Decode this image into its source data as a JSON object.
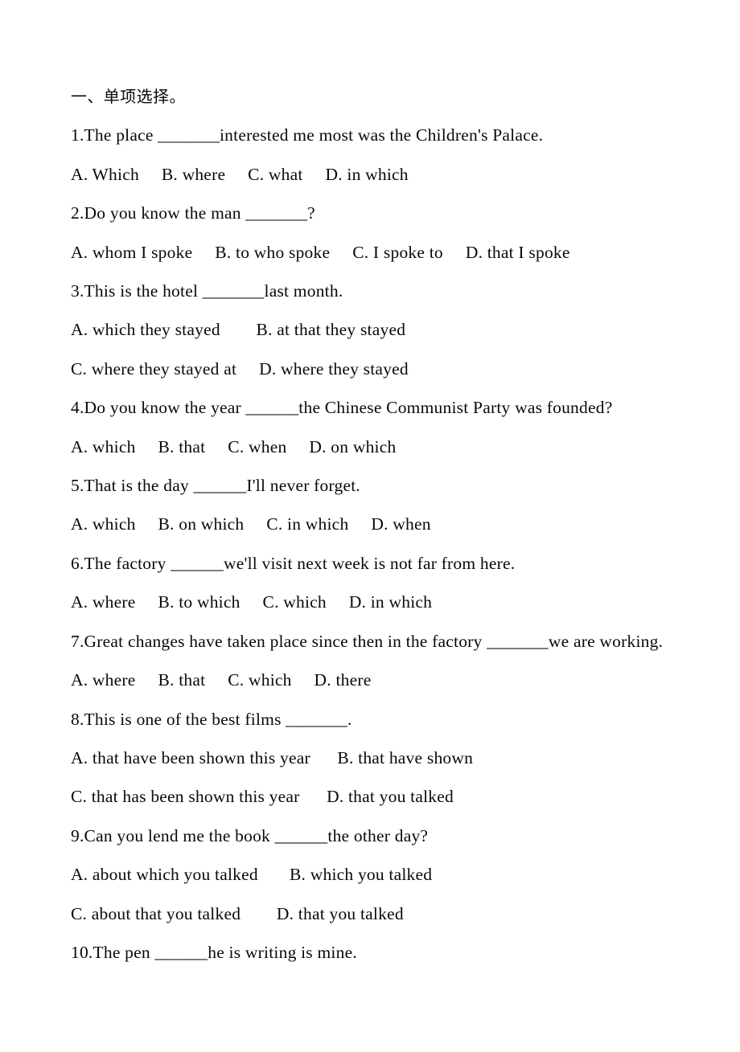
{
  "document": {
    "title": "一、单项选择。",
    "background_color": "#ffffff",
    "text_color": "#000000",
    "heading": "一、单项选择。",
    "lines": [
      {
        "id": "heading",
        "kind": "heading",
        "text": "一、单项选择。"
      },
      {
        "id": "q1",
        "kind": "question",
        "text": "1.The place _______interested me most was the Children's Palace."
      },
      {
        "id": "q1-opts",
        "kind": "options",
        "text": "A. Which     B. where     C. what     D. in which"
      },
      {
        "id": "q2",
        "kind": "question",
        "text": "2.Do you know the man _______?"
      },
      {
        "id": "q2-opts",
        "kind": "options",
        "text": "A. whom I spoke     B. to who spoke     C. I spoke to     D. that I spoke"
      },
      {
        "id": "q3",
        "kind": "question",
        "text": "3.This is the hotel _______last month."
      },
      {
        "id": "q3-optsAB",
        "kind": "options",
        "text": "A. which they stayed        B. at that they stayed"
      },
      {
        "id": "q3-optsCD",
        "kind": "options",
        "text": "C. where they stayed at     D. where they stayed"
      },
      {
        "id": "q4",
        "kind": "question",
        "text": "4.Do you know the year ______the Chinese Communist Party was founded?"
      },
      {
        "id": "q4-opts",
        "kind": "options",
        "text": "A. which     B. that     C. when     D. on which"
      },
      {
        "id": "q5",
        "kind": "question",
        "text": "5.That is the day ______I'll never forget."
      },
      {
        "id": "q5-opts",
        "kind": "options",
        "text": "A. which     B. on which     C. in which     D. when"
      },
      {
        "id": "q6",
        "kind": "question",
        "text": "6.The factory ______we'll visit next week is not far from here."
      },
      {
        "id": "q6-opts",
        "kind": "options",
        "text": "A. where     B. to which     C. which     D. in which"
      },
      {
        "id": "q7",
        "kind": "question",
        "text": "7.Great changes have taken place since then in the factory _______we are working."
      },
      {
        "id": "q7-opts",
        "kind": "options",
        "text": "A. where     B. that     C. which     D. there"
      },
      {
        "id": "q8",
        "kind": "question",
        "text": "8.This is one of the best films _______."
      },
      {
        "id": "q8-optsAB",
        "kind": "options",
        "text": "A. that have been shown this year      B. that have shown"
      },
      {
        "id": "q8-optsCD",
        "kind": "options",
        "text": "C. that has been shown this year      D. that you talked"
      },
      {
        "id": "q9",
        "kind": "question",
        "text": "9.Can you lend me the book ______the other day?"
      },
      {
        "id": "q9-optsAB",
        "kind": "options",
        "text": "A. about which you talked       B. which you talked"
      },
      {
        "id": "q9-optsCD",
        "kind": "options",
        "text": "C. about that you talked        D. that you talked"
      },
      {
        "id": "q10",
        "kind": "question",
        "text": "10.The pen ______he is writing is mine."
      }
    ],
    "questions": [
      {
        "number": "1",
        "stem": "1.The place _______interested me most was the Children's Palace.",
        "options": [
          "A. Which",
          "B. where",
          "C. what",
          "D. in which"
        ]
      },
      {
        "number": "2",
        "stem": "2.Do you know the man _______?",
        "options": [
          "A. whom I spoke",
          "B. to who spoke",
          "C. I spoke to",
          "D. that I spoke"
        ]
      },
      {
        "number": "3",
        "stem": "3.This is the hotel _______last month.",
        "options": [
          "A. which they stayed",
          "B. at that they stayed",
          "C. where they stayed at",
          "D. where they stayed"
        ]
      },
      {
        "number": "4",
        "stem": "4.Do you know the year ______the Chinese Communist Party was founded?",
        "options": [
          "A. which",
          "B. that",
          "C. when",
          "D. on which"
        ]
      },
      {
        "number": "5",
        "stem": "5.That is the day ______I'll never forget.",
        "options": [
          "A. which",
          "B. on which",
          "C. in which",
          "D. when"
        ]
      },
      {
        "number": "6",
        "stem": "6.The factory ______we'll visit next week is not far from here.",
        "options": [
          "A. where",
          "B. to which",
          "C. which",
          "D. in which"
        ]
      },
      {
        "number": "7",
        "stem": "7.Great changes have taken place since then in the factory _______we are working.",
        "options": [
          "A. where",
          "B. that",
          "C. which",
          "D. there"
        ]
      },
      {
        "number": "8",
        "stem": "8.This is one of the best films _______.",
        "options": [
          "A. that have been shown this year",
          "B. that have shown",
          "C. that has been shown this year",
          "D. that you talked"
        ]
      },
      {
        "number": "9",
        "stem": "9.Can you lend me the book ______the other day?",
        "options": [
          "A. about which you talked",
          "B. which you talked",
          "C. about that you talked",
          "D. that you talked"
        ]
      },
      {
        "number": "10",
        "stem": "10.The pen ______he is writing is mine.",
        "options": []
      }
    ]
  }
}
